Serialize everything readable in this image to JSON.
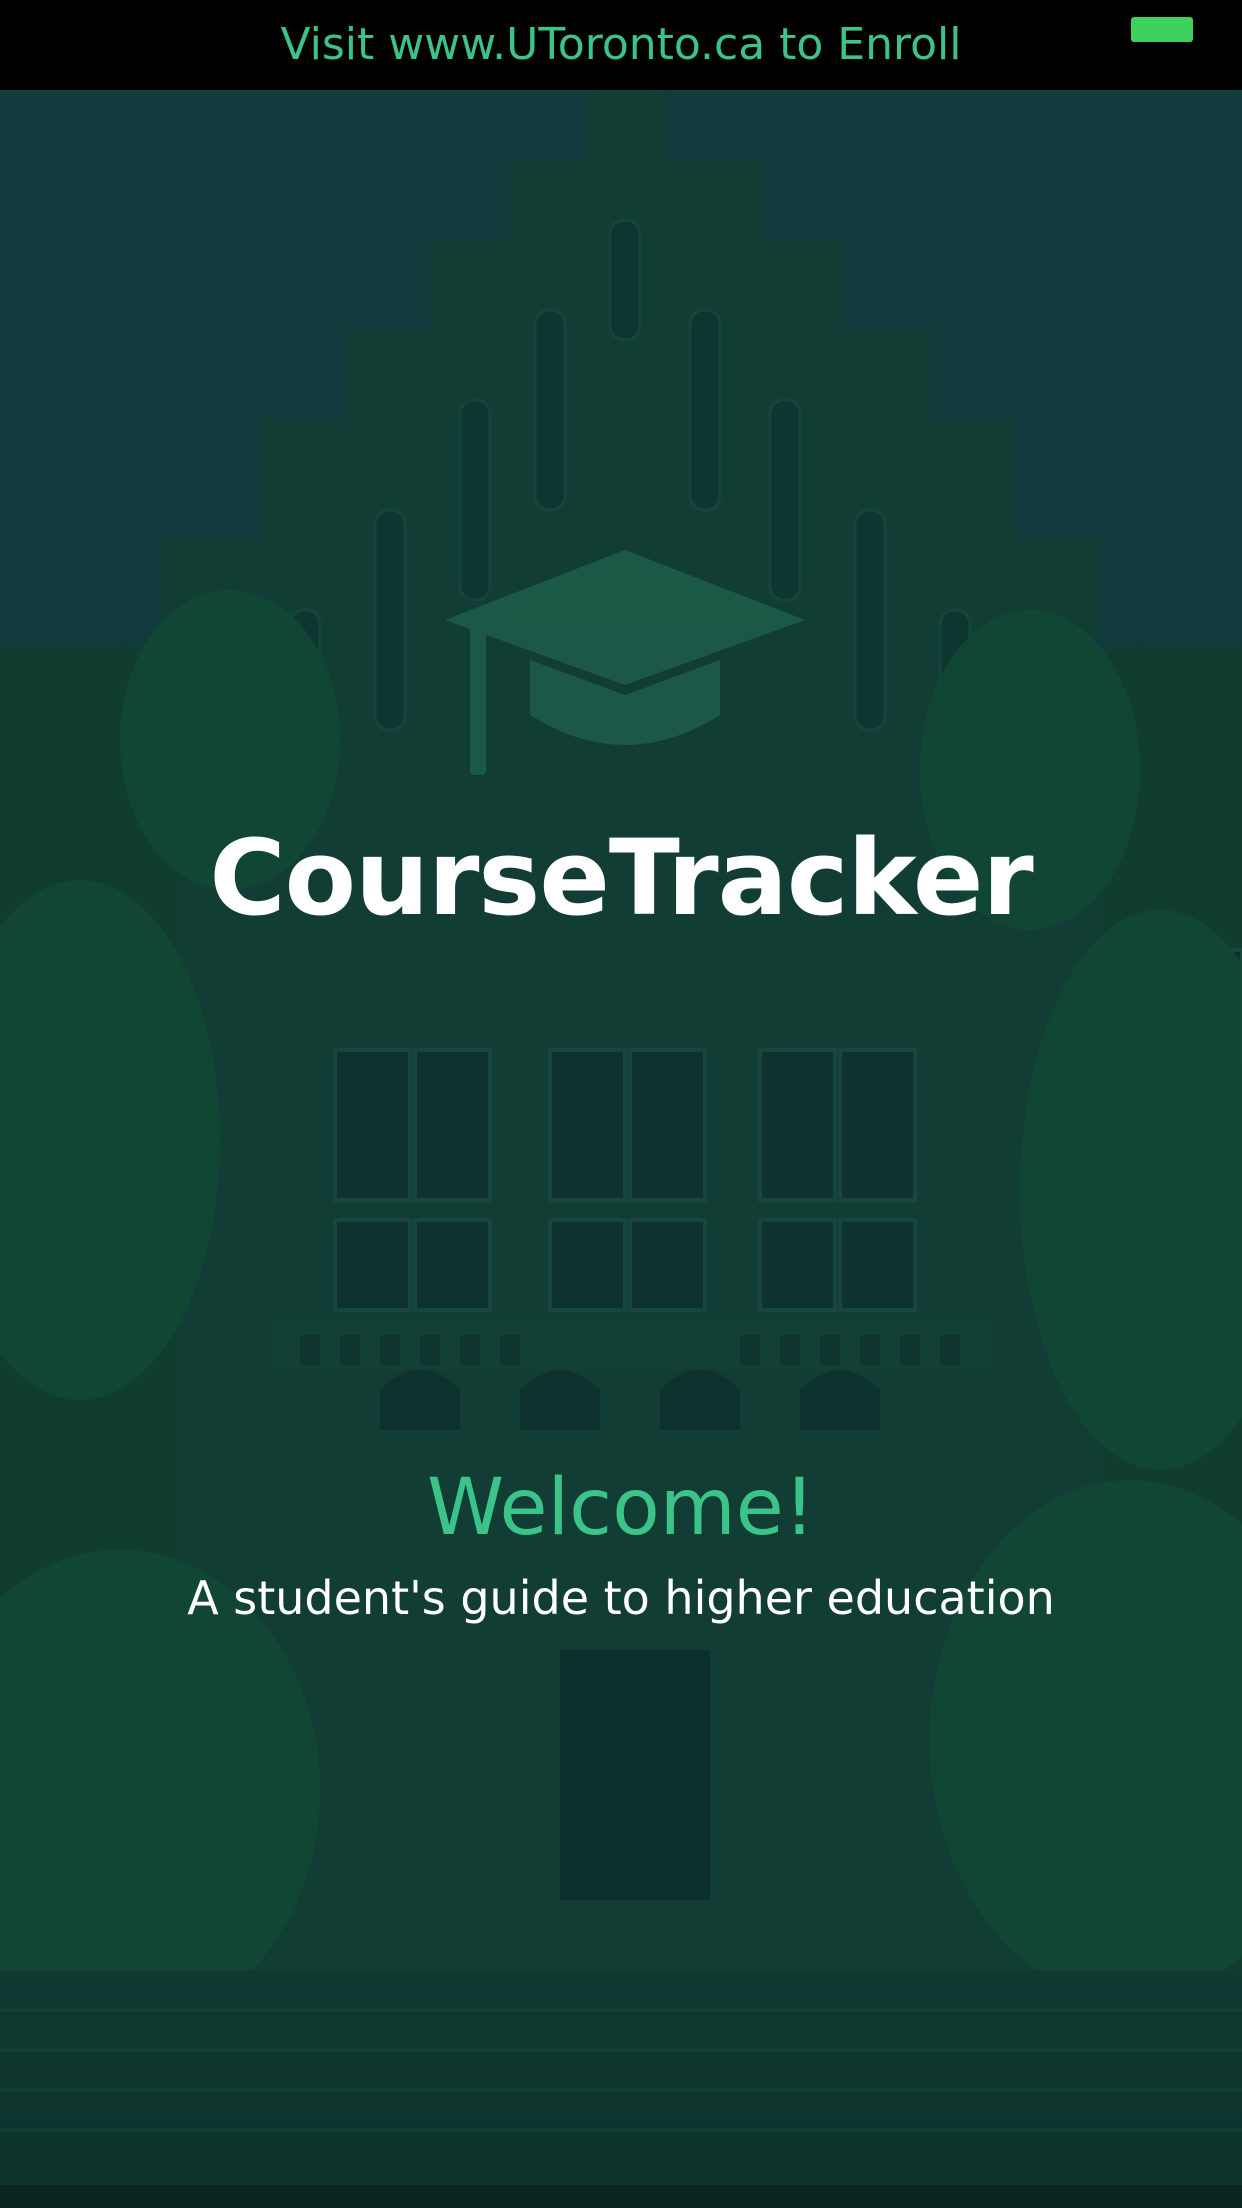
{
  "banner": {
    "text": "Visit www.UToronto.ca to Enroll",
    "battery_icon": "battery-icon"
  },
  "background": {
    "description_icon": "university-building-photo"
  },
  "logo": {
    "icon": "graduation-cap-icon"
  },
  "app": {
    "title": "CourseTracker"
  },
  "welcome": {
    "heading": "Welcome!",
    "tagline": "A student's guide to higher education"
  },
  "colors": {
    "accent": "#3cc389",
    "overlay": "#0d3a35",
    "banner_bg": "#000000",
    "battery": "#3fd15e"
  }
}
